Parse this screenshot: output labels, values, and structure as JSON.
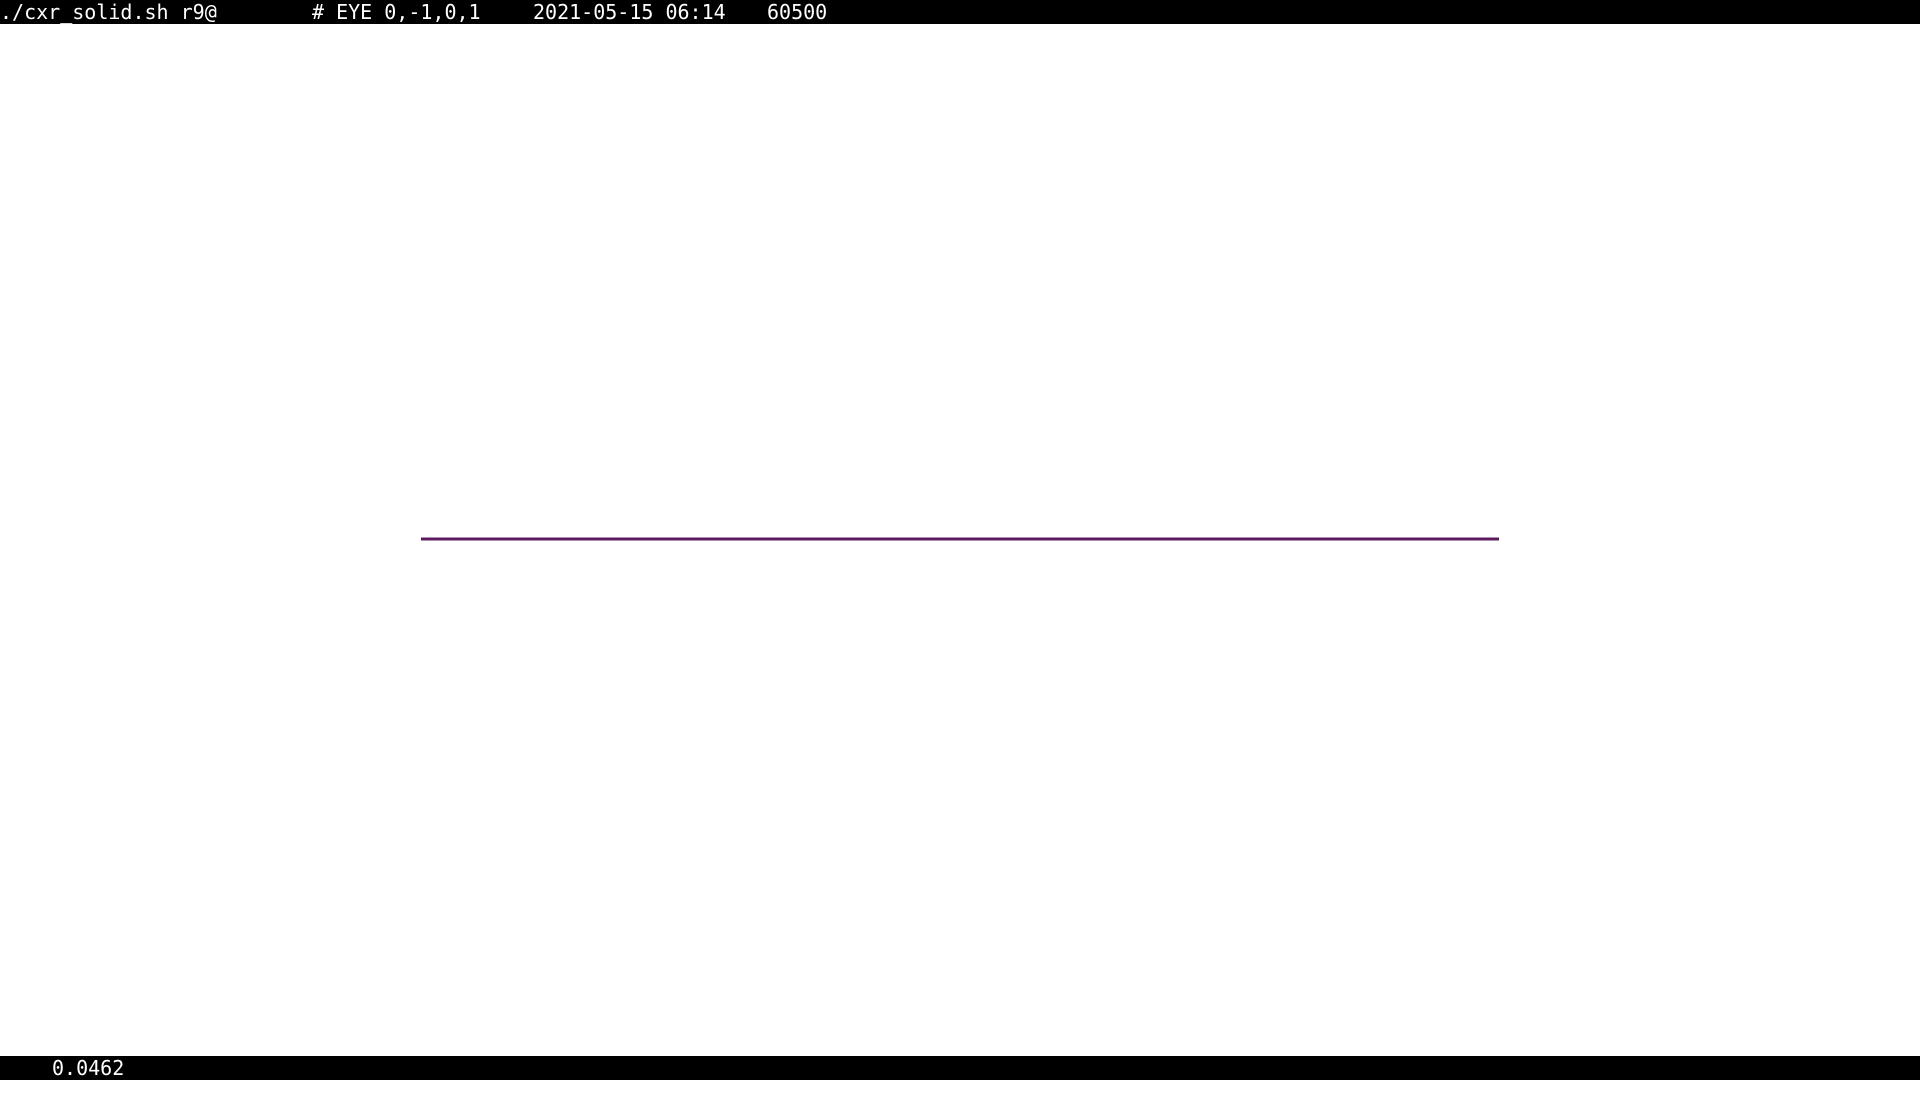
{
  "title_bar": {
    "command": "./cxr_solid.sh r9@",
    "eye": "# EYE 0,-1,0,1",
    "datetime": "2021-05-15 06:14",
    "frame": "60500"
  },
  "scene": {
    "line_color": "#5e1a5e",
    "background_color": "#ffffff"
  },
  "status_bar": {
    "value": "0.0462"
  }
}
